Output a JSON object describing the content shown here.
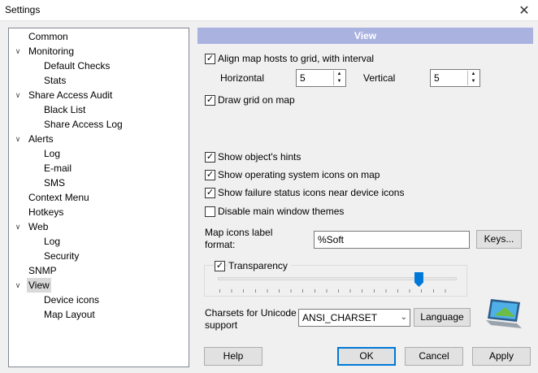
{
  "window": {
    "title": "Settings"
  },
  "tree": [
    {
      "label": "Common"
    },
    {
      "label": "Monitoring",
      "expanded": true
    },
    {
      "label": "Default Checks"
    },
    {
      "label": "Stats"
    },
    {
      "label": "Share Access Audit",
      "expanded": true
    },
    {
      "label": "Black List"
    },
    {
      "label": "Share Access Log"
    },
    {
      "label": "Alerts",
      "expanded": true
    },
    {
      "label": "Log"
    },
    {
      "label": "E-mail"
    },
    {
      "label": "SMS"
    },
    {
      "label": "Context Menu"
    },
    {
      "label": "Hotkeys"
    },
    {
      "label": "Web",
      "expanded": true
    },
    {
      "label": "Log"
    },
    {
      "label": "Security"
    },
    {
      "label": "SNMP"
    },
    {
      "label": "View",
      "expanded": true,
      "selected": true
    },
    {
      "label": "Device icons"
    },
    {
      "label": "Map Layout"
    }
  ],
  "view": {
    "header": "View",
    "align_grid": {
      "label": "Align map hosts to grid, with interval",
      "checked": true
    },
    "horizontal": {
      "label": "Horizontal",
      "value": "5"
    },
    "vertical": {
      "label": "Vertical",
      "value": "5"
    },
    "draw_grid": {
      "label": "Draw grid on map",
      "checked": true
    },
    "show_hints": {
      "label": "Show object's hints",
      "checked": true
    },
    "show_os_icons": {
      "label": "Show operating system icons on map",
      "checked": true
    },
    "show_failure": {
      "label": "Show failure status icons near device icons",
      "checked": true
    },
    "disable_themes": {
      "label": "Disable main window themes",
      "checked": false
    },
    "map_label": {
      "label_line1": "Map icons label",
      "label_line2": "format:",
      "value": "%Soft",
      "keys_button": "Keys..."
    },
    "transparency": {
      "label": "Transparency",
      "checked": true,
      "level_percent": 84
    },
    "charsets": {
      "label_line1": "Charsets for Unicode",
      "label_line2": "support",
      "value": "ANSI_CHARSET",
      "language_button": "Language"
    }
  },
  "buttons": {
    "help": "Help",
    "ok": "OK",
    "cancel": "Cancel",
    "apply": "Apply"
  },
  "check_glyph": "✓",
  "icons": {
    "close": "close-icon",
    "chevron": "chevron-down-icon"
  }
}
